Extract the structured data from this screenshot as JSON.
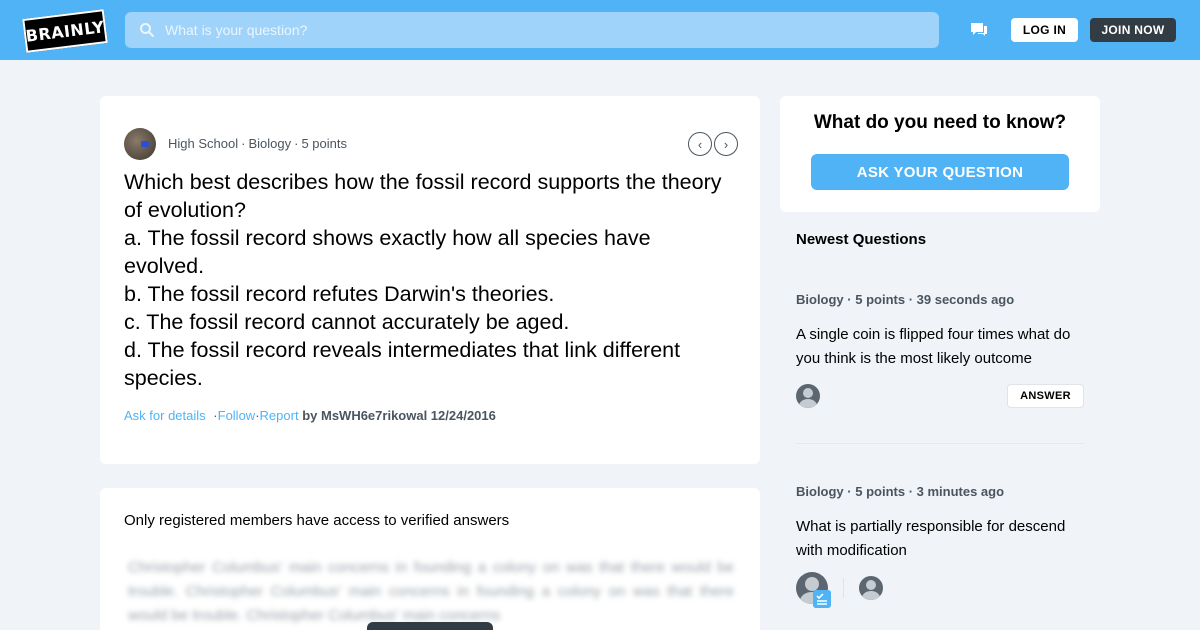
{
  "header": {
    "logo_text": "BRAINLY",
    "search_placeholder": "What is your question?",
    "login_label": "LOG IN",
    "join_label": "JOIN NOW",
    "icons": [
      "search-icon",
      "chat-bubbles-icon"
    ]
  },
  "question": {
    "grade": "High School",
    "subject": "Biology",
    "points": "5 points",
    "text": "Which best describes how the fossil record supports the theory of evolution?\na. The fossil record shows exactly how all species have evolved.\nb. The fossil record refutes Darwin's theories.\nc. The fossil record cannot accurately be aged.\nd. The fossil record reveals intermediates that link different species.",
    "ask_details": "Ask for details",
    "follow": "Follow",
    "report": "Report",
    "author_line": "by MsWH6e7rikowal 12/24/2016",
    "prev_arrow": "‹",
    "next_arrow": "›"
  },
  "answer_section": {
    "title": "Only registered members have access to verified answers",
    "blurred_text": "Christopher Columbus' main concerns in founding a colony on was that there would be trouble. Christopher Columbus' main concerns in founding a colony on was that there would be trouble. Christopher Columbus' main concerns"
  },
  "sidebar": {
    "ask_heading": "What do you need to know?",
    "ask_button": "ASK YOUR QUESTION",
    "newest_heading": "Newest Questions",
    "questions": [
      {
        "subject": "Biology",
        "points": "5 points",
        "time": "39 seconds ago",
        "text": "A single coin is flipped four times what do you think is the most likely outcome",
        "answer_button": "ANSWER"
      },
      {
        "subject": "Biology",
        "points": "5 points",
        "time": "3 minutes ago",
        "text": "What is partially responsible for descend with modification"
      }
    ]
  },
  "colors": {
    "brand_blue": "#4fb3f6",
    "dark": "#323c45",
    "background": "#f0f3f7"
  }
}
